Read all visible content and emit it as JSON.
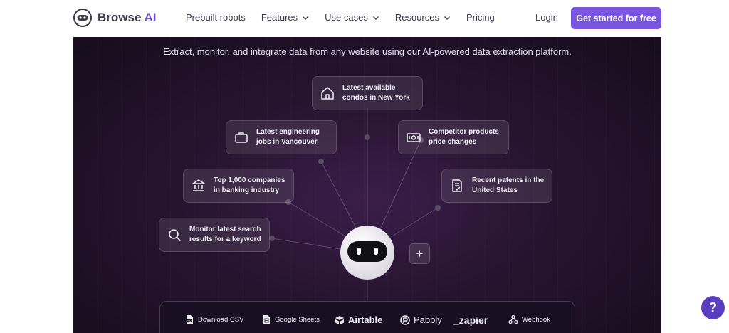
{
  "brand": {
    "name": "Browse",
    "suffix": "AI"
  },
  "nav": {
    "items": [
      {
        "label": "Prebuilt robots",
        "dropdown": false
      },
      {
        "label": "Features",
        "dropdown": true
      },
      {
        "label": "Use cases",
        "dropdown": true
      },
      {
        "label": "Resources",
        "dropdown": true
      },
      {
        "label": "Pricing",
        "dropdown": false
      }
    ],
    "login": "Login",
    "cta": "Get started for free"
  },
  "hero": {
    "tagline": "Extract, monitor, and integrate data from any website using our AI-powered data extraction platform.",
    "cards": [
      {
        "line1": "Latest available",
        "line2": "condos in New York",
        "icon": "house-icon"
      },
      {
        "line1": "Latest engineering",
        "line2": "jobs in Vancouver",
        "icon": "briefcase-icon"
      },
      {
        "line1": "Competitor products",
        "line2": "price changes",
        "icon": "money-icon"
      },
      {
        "line1": "Top 1,000 companies",
        "line2": "in banking industry",
        "icon": "bank-icon"
      },
      {
        "line1": "Recent patents in the",
        "line2": "United States",
        "icon": "document-check-icon"
      },
      {
        "line1": "Monitor latest search",
        "line2": "results for a keyword",
        "icon": "search-icon"
      }
    ],
    "plus": "+"
  },
  "integrations": [
    {
      "label": "Download CSV",
      "icon": "csv-file-icon"
    },
    {
      "label": "Google Sheets",
      "icon": "sheets-icon"
    },
    {
      "label": "Airtable",
      "icon": "airtable-icon"
    },
    {
      "label": "Pabbly",
      "icon": "pabbly-icon"
    },
    {
      "label": "_zapier",
      "icon": ""
    },
    {
      "label": "Webhook",
      "icon": "webhook-icon"
    }
  ],
  "help": "?",
  "colors": {
    "accent": "#7a55e0",
    "hero_bg": "#26142f",
    "help": "#5b3dbf"
  }
}
